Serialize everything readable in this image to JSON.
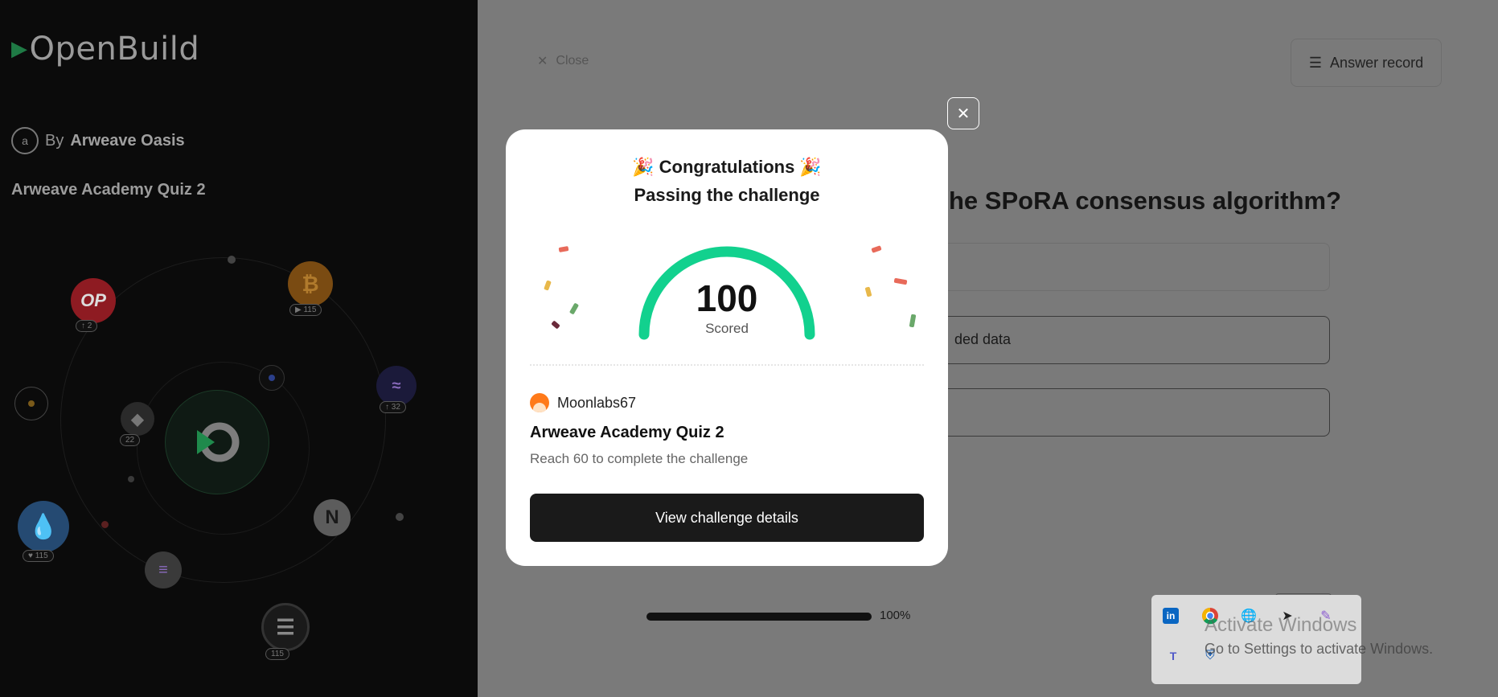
{
  "left": {
    "logo": "OpenBuild",
    "by_prefix": "By",
    "author": "Arweave Oasis",
    "quiz_title": "Arweave Academy Quiz 2",
    "badges": {
      "op": "↑ 2",
      "btc": "▶ 115",
      "eth": "22",
      "sui": "♥ 115",
      "arc": "↑ 32",
      "bottom": "115"
    }
  },
  "background": {
    "close_label": "Close",
    "answer_record_label": "Answer record",
    "question_fragment": "he SPoRA consensus algorithm?",
    "option_fragment": "ded data",
    "progress_percent": 100,
    "progress_label": "100%"
  },
  "modal": {
    "congrats": "🎉 Congratulations 🎉",
    "passing": "Passing the challenge",
    "score": "100",
    "scored_label": "Scored",
    "username": "Moonlabs67",
    "quiz_title": "Arweave Academy Quiz 2",
    "description": "Reach 60 to complete the challenge",
    "view_button": "View challenge details",
    "gauge_color": "#12d18e"
  },
  "tray": {
    "icons": [
      "linkedin-icon",
      "chrome-icon",
      "network-globe-icon",
      "telegram-icon",
      "pen-icon",
      "teams-icon",
      "defender-icon"
    ],
    "watermark_title": "Activate Windows",
    "watermark_subtitle": "Go to Settings to activate Windows."
  }
}
